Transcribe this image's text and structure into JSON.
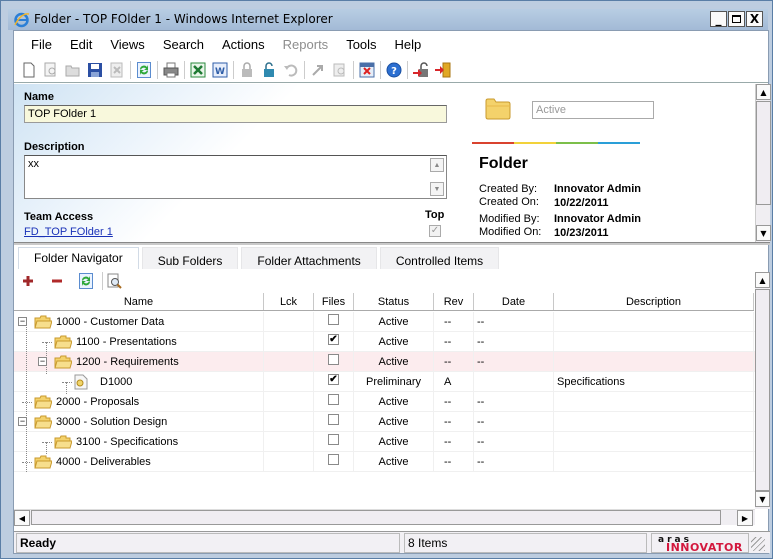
{
  "window": {
    "title": "Folder - TOP FOlder 1 - Windows Internet Explorer",
    "controls": {
      "minimize": "_",
      "maximize": "□",
      "close": "X"
    }
  },
  "menubar": {
    "items": [
      {
        "label": "File",
        "disabled": false
      },
      {
        "label": "Edit",
        "disabled": false
      },
      {
        "label": "Views",
        "disabled": false
      },
      {
        "label": "Search",
        "disabled": false
      },
      {
        "label": "Actions",
        "disabled": false
      },
      {
        "label": "Reports",
        "disabled": true
      },
      {
        "label": "Tools",
        "disabled": false
      },
      {
        "label": "Help",
        "disabled": false
      }
    ]
  },
  "toolbar": {
    "buttons": [
      {
        "icon": "new-document-icon",
        "enabled": true
      },
      {
        "icon": "view-icon",
        "enabled": false
      },
      {
        "icon": "open-icon",
        "enabled": false
      },
      {
        "icon": "save-icon",
        "enabled": true
      },
      {
        "icon": "delete-icon",
        "enabled": false
      },
      {
        "icon": "separator"
      },
      {
        "icon": "refresh-icon",
        "enabled": true
      },
      {
        "icon": "separator"
      },
      {
        "icon": "print-icon",
        "enabled": true
      },
      {
        "icon": "separator"
      },
      {
        "icon": "excel-icon",
        "enabled": true
      },
      {
        "icon": "word-icon",
        "enabled": true
      },
      {
        "icon": "separator"
      },
      {
        "icon": "lock-icon",
        "enabled": false
      },
      {
        "icon": "unlock-icon",
        "enabled": true
      },
      {
        "icon": "undo-icon",
        "enabled": false
      },
      {
        "icon": "separator"
      },
      {
        "icon": "promote-icon",
        "enabled": false
      },
      {
        "icon": "find-document-icon",
        "enabled": false
      },
      {
        "icon": "separator"
      },
      {
        "icon": "close-form-icon",
        "enabled": true
      },
      {
        "icon": "separator"
      },
      {
        "icon": "help-icon",
        "enabled": true
      },
      {
        "icon": "separator"
      },
      {
        "icon": "unlock-close-icon",
        "enabled": true
      },
      {
        "icon": "exit-icon",
        "enabled": true
      }
    ]
  },
  "form": {
    "name_label": "Name",
    "name_value": "TOP FOlder 1",
    "description_label": "Description",
    "description_value": "xx",
    "team_access_label": "Team Access",
    "team_access_link": "FD_TOP FOlder 1",
    "top_label": "Top",
    "top_checked": true,
    "state_value": "Active",
    "rainbow_colors": [
      "#d9432f",
      "#f2d23a",
      "#7cbf4a",
      "#2a9fd8"
    ],
    "item_type": "Folder",
    "meta": [
      {
        "label": "Created By:",
        "value": "Innovator Admin"
      },
      {
        "label": "Created On:",
        "value": "10/22/2011"
      },
      {
        "label": "Modified By:",
        "value": "Innovator Admin"
      },
      {
        "label": "Modified On:",
        "value": "10/23/2011"
      }
    ]
  },
  "tabs": [
    {
      "label": "Folder Navigator",
      "active": true
    },
    {
      "label": "Sub Folders",
      "active": false
    },
    {
      "label": "Folder Attachments",
      "active": false
    },
    {
      "label": "Controlled Items",
      "active": false
    }
  ],
  "grid_toolbar": {
    "buttons": [
      "add-icon",
      "remove-icon",
      "refresh-icon",
      "search-icon"
    ]
  },
  "grid": {
    "columns": [
      "Name",
      "Lck",
      "Files",
      "Status",
      "Rev",
      "Date",
      "Description"
    ],
    "rows": [
      {
        "name": "1000 - Customer Data",
        "level": 0,
        "type": "folder",
        "expandable": true,
        "lck": "",
        "files": false,
        "status": "Active",
        "rev": "--",
        "date": "--",
        "description": "",
        "selected": false
      },
      {
        "name": "1100 - Presentations",
        "level": 1,
        "type": "folder",
        "expandable": false,
        "lck": "",
        "files": true,
        "status": "Active",
        "rev": "--",
        "date": "--",
        "description": "",
        "selected": false
      },
      {
        "name": "1200 - Requirements",
        "level": 1,
        "type": "folder",
        "expandable": true,
        "lck": "",
        "files": false,
        "status": "Active",
        "rev": "--",
        "date": "--",
        "description": "",
        "selected": true
      },
      {
        "name": "D1000",
        "level": 2,
        "type": "document",
        "expandable": false,
        "lck": "",
        "files": true,
        "status": "Preliminary",
        "rev": "A",
        "date": "",
        "description": "Specifications",
        "selected": false
      },
      {
        "name": "2000 - Proposals",
        "level": 0,
        "type": "folder",
        "expandable": false,
        "lck": "",
        "files": false,
        "status": "Active",
        "rev": "--",
        "date": "--",
        "description": "",
        "selected": false
      },
      {
        "name": "3000 - Solution Design",
        "level": 0,
        "type": "folder",
        "expandable": true,
        "lck": "",
        "files": false,
        "status": "Active",
        "rev": "--",
        "date": "--",
        "description": "",
        "selected": false
      },
      {
        "name": "3100 - Specifications",
        "level": 1,
        "type": "folder",
        "expandable": false,
        "lck": "",
        "files": false,
        "status": "Active",
        "rev": "--",
        "date": "--",
        "description": "",
        "selected": false
      },
      {
        "name": "4000 - Deliverables",
        "level": 0,
        "type": "folder",
        "expandable": false,
        "lck": "",
        "files": false,
        "status": "Active",
        "rev": "--",
        "date": "--",
        "description": "",
        "selected": false
      }
    ]
  },
  "statusbar": {
    "status": "Ready",
    "count": "8 Items",
    "logo_top": "aras",
    "logo_bottom": "INNOVATOR",
    "logo_color": "#d3173d"
  }
}
